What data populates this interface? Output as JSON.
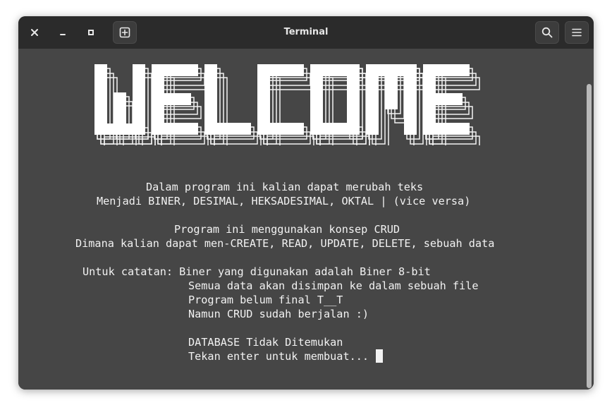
{
  "window": {
    "title": "Terminal"
  },
  "titlebar": {
    "icons": [
      "close-icon",
      "minimize-icon",
      "maximize-icon",
      "new-tab-icon",
      "search-icon",
      "menu-icon"
    ]
  },
  "banner": {
    "text": "WELCOME"
  },
  "terminal": {
    "lines": [
      "Dalam program ini kalian dapat merubah teks",
      "Menjadi BINER, DESIMAL, HEKSADESIMAL, OKTAL | (vice versa)",
      "Program ini menggunakan konsep CRUD",
      "Dimana kalian dapat men-CREATE, READ, UPDATE, DELETE, sebuah data",
      "Untuk catatan: Biner yang digunakan adalah Biner 8-bit",
      "Semua data akan disimpan ke dalam sebuah file",
      "Program belum final T__T",
      "Namun CRUD sudah berjalan :)",
      "DATABASE Tidak Ditemukan",
      "Tekan enter untuk membuat... "
    ]
  },
  "colors": {
    "background": "#464646",
    "titlebar": "#2b2b2b",
    "text": "#f2f2f2"
  }
}
